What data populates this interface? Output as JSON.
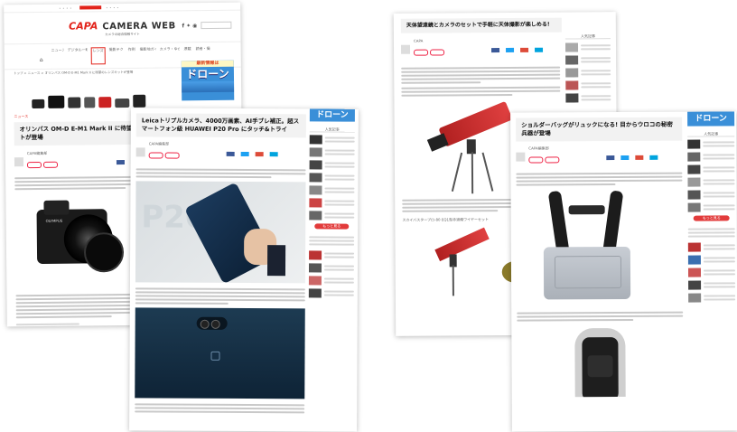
{
  "page1": {
    "logo_mark": "CAPA",
    "logo_text": "CAMERA WEB",
    "tagline": "カメラの総合情報サイト",
    "nav": [
      "ニュース",
      "デジタル一眼・ミラーレス",
      "レンズ",
      "撮影テク",
      "作例",
      "撮影地ガイド",
      "カメラ・ゆかり",
      "連載",
      "読者・撮影"
    ],
    "breadcrumb": "トップ > ニュース > オリンパス OM-D E-M1 Mark II に待望のレンズキットが登場",
    "category": "ニュース",
    "title": "オリンパス OM-D E-M1 Mark II に待望のレンズキットが登場",
    "author": "CAPA編集部",
    "camera_brand": "OLYMPUS",
    "ad_title_small": "最新情報は",
    "ad_title": "ドローン"
  },
  "page2": {
    "title": "Leicaトリプルカメラ、4000万画素、AI手ブレ補正。超スマートフォン級 HUAWEI P20 Pro にタッチ&トライ",
    "author": "CAPA編集部",
    "phone_label": "P20",
    "ad_title": "ドローン",
    "sidebar_head": "人気記事",
    "more_btn": "もっと見る"
  },
  "page3": {
    "title": "天体望遠鏡とカメラのセットで手軽に天体撮影が楽しめる!",
    "author": "CAPA",
    "sidebar_head": "人気記事",
    "caption": "スカイバスタープロ-80 EQ1型赤道儀ワイヤーセット"
  },
  "page4": {
    "title": "ショルダーバッグがリュックになる! 目からウロコの秘密兵器が登場",
    "author": "CAPA編集部",
    "ad_title": "ドローン",
    "sidebar_head": "人気記事",
    "more_btn": "もっと見る"
  },
  "colors": {
    "accent": "#e2231a",
    "facebook": "#3b5998",
    "twitter": "#1da1f2",
    "ad_blue": "#3a8fd8"
  }
}
